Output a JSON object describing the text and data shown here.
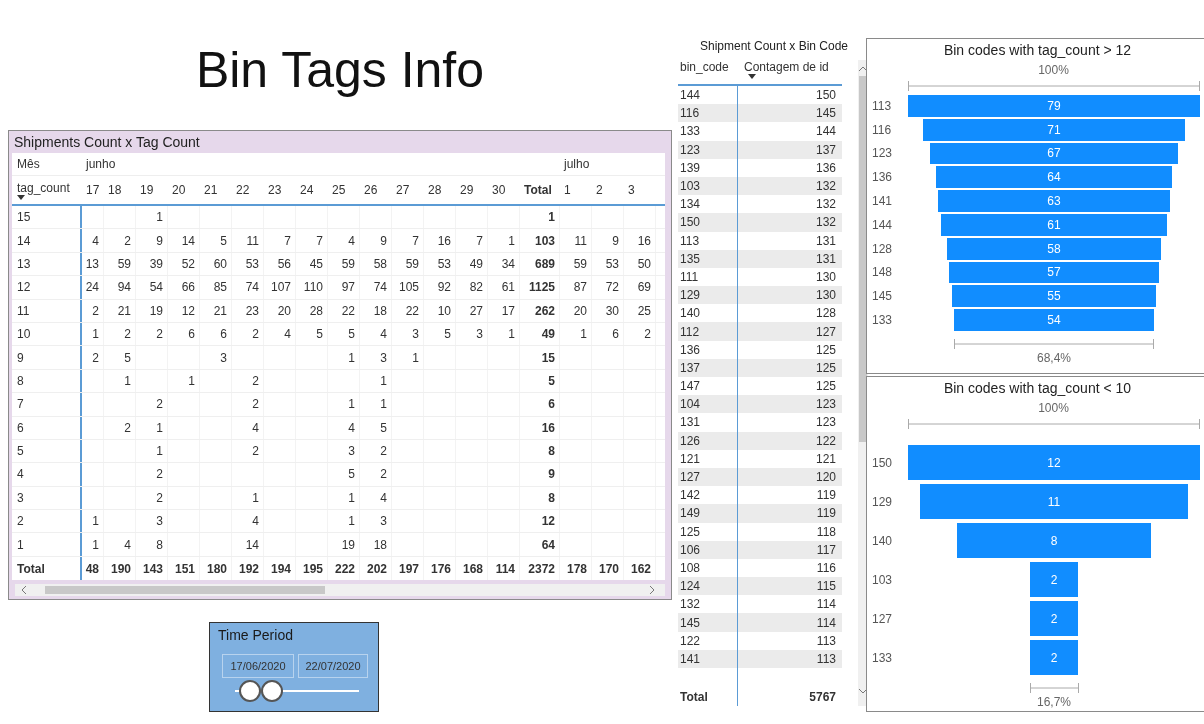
{
  "page_title": "Bin Tags Info",
  "matrix": {
    "title": "Shipments Count x Tag Count",
    "month_header": "Mês",
    "row_header": {
      "label": "tag_count",
      "sorted": true
    },
    "columns": [
      {
        "label": "17",
        "kind": "day",
        "month": "junho"
      },
      {
        "label": "18",
        "kind": "day"
      },
      {
        "label": "19",
        "kind": "day"
      },
      {
        "label": "20",
        "kind": "day"
      },
      {
        "label": "21",
        "kind": "day"
      },
      {
        "label": "22",
        "kind": "day"
      },
      {
        "label": "23",
        "kind": "day"
      },
      {
        "label": "24",
        "kind": "day"
      },
      {
        "label": "25",
        "kind": "day"
      },
      {
        "label": "26",
        "kind": "day"
      },
      {
        "label": "27",
        "kind": "day"
      },
      {
        "label": "28",
        "kind": "day"
      },
      {
        "label": "29",
        "kind": "day"
      },
      {
        "label": "30",
        "kind": "day"
      },
      {
        "label": "Total",
        "kind": "total"
      },
      {
        "label": "1",
        "kind": "day",
        "month": "julho"
      },
      {
        "label": "2",
        "kind": "day"
      },
      {
        "label": "3",
        "kind": "day"
      }
    ],
    "rows": [
      {
        "label": "15",
        "kind": "value",
        "cells": [
          null,
          null,
          "1",
          null,
          null,
          null,
          null,
          null,
          null,
          null,
          null,
          null,
          null,
          null,
          "1",
          null,
          null,
          null
        ]
      },
      {
        "label": "14",
        "kind": "value",
        "cells": [
          "4",
          "2",
          "9",
          "14",
          "5",
          "11",
          "7",
          "7",
          "4",
          "9",
          "7",
          "16",
          "7",
          "1",
          "103",
          "11",
          "9",
          "16"
        ]
      },
      {
        "label": "13",
        "kind": "value",
        "cells": [
          "13",
          "59",
          "39",
          "52",
          "60",
          "53",
          "56",
          "45",
          "59",
          "58",
          "59",
          "53",
          "49",
          "34",
          "689",
          "59",
          "53",
          "50"
        ]
      },
      {
        "label": "12",
        "kind": "value",
        "cells": [
          "24",
          "94",
          "54",
          "66",
          "85",
          "74",
          "107",
          "110",
          "97",
          "74",
          "105",
          "92",
          "82",
          "61",
          "1125",
          "87",
          "72",
          "69"
        ]
      },
      {
        "label": "11",
        "kind": "value",
        "cells": [
          "2",
          "21",
          "19",
          "12",
          "21",
          "23",
          "20",
          "28",
          "22",
          "18",
          "22",
          "10",
          "27",
          "17",
          "262",
          "20",
          "30",
          "25"
        ]
      },
      {
        "label": "10",
        "kind": "value",
        "cells": [
          "1",
          "2",
          "2",
          "6",
          "6",
          "2",
          "4",
          "5",
          "5",
          "4",
          "3",
          "5",
          "3",
          "1",
          "49",
          "1",
          "6",
          "2"
        ]
      },
      {
        "label": "9",
        "kind": "value",
        "cells": [
          "2",
          "5",
          null,
          null,
          "3",
          null,
          null,
          null,
          "1",
          "3",
          "1",
          null,
          null,
          null,
          "15",
          null,
          null,
          null
        ]
      },
      {
        "label": "8",
        "kind": "value",
        "cells": [
          null,
          "1",
          null,
          "1",
          null,
          "2",
          null,
          null,
          null,
          "1",
          null,
          null,
          null,
          null,
          "5",
          null,
          null,
          null
        ]
      },
      {
        "label": "7",
        "kind": "value",
        "cells": [
          null,
          null,
          "2",
          null,
          null,
          "2",
          null,
          null,
          "1",
          "1",
          null,
          null,
          null,
          null,
          "6",
          null,
          null,
          null
        ]
      },
      {
        "label": "6",
        "kind": "value",
        "cells": [
          null,
          "2",
          "1",
          null,
          null,
          "4",
          null,
          null,
          "4",
          "5",
          null,
          null,
          null,
          null,
          "16",
          null,
          null,
          null
        ]
      },
      {
        "label": "5",
        "kind": "value",
        "cells": [
          null,
          null,
          "1",
          null,
          null,
          "2",
          null,
          null,
          "3",
          "2",
          null,
          null,
          null,
          null,
          "8",
          null,
          null,
          null
        ]
      },
      {
        "label": "4",
        "kind": "value",
        "cells": [
          null,
          null,
          "2",
          null,
          null,
          null,
          null,
          null,
          "5",
          "2",
          null,
          null,
          null,
          null,
          "9",
          null,
          null,
          null
        ]
      },
      {
        "label": "3",
        "kind": "value",
        "cells": [
          null,
          null,
          "2",
          null,
          null,
          "1",
          null,
          null,
          "1",
          "4",
          null,
          null,
          null,
          null,
          "8",
          null,
          null,
          null
        ]
      },
      {
        "label": "2",
        "kind": "value",
        "cells": [
          "1",
          null,
          "3",
          null,
          null,
          "4",
          null,
          null,
          "1",
          "3",
          null,
          null,
          null,
          null,
          "12",
          null,
          null,
          null
        ]
      },
      {
        "label": "1",
        "kind": "value",
        "cells": [
          "1",
          "4",
          "8",
          null,
          null,
          "14",
          null,
          null,
          "19",
          "18",
          null,
          null,
          null,
          null,
          "64",
          null,
          null,
          null
        ]
      },
      {
        "label": "Total",
        "kind": "total",
        "cells": [
          "48",
          "190",
          "143",
          "151",
          "180",
          "192",
          "194",
          "195",
          "222",
          "202",
          "197",
          "176",
          "168",
          "114",
          "2372",
          "178",
          "170",
          "162"
        ]
      }
    ]
  },
  "slicer": {
    "title": "Time Period",
    "start_date": "17/06/2020",
    "end_date": "22/07/2020",
    "thumbs": [
      {
        "level": 0.08
      },
      {
        "level": 0.26
      }
    ]
  },
  "bin_table": {
    "title": "Shipment Count x Bin Code",
    "columns": [
      {
        "label": "bin_code",
        "sorted": false
      },
      {
        "label": "Contagem de id",
        "sorted": true
      }
    ],
    "rows": [
      [
        "144",
        "150"
      ],
      [
        "116",
        "145"
      ],
      [
        "133",
        "144"
      ],
      [
        "123",
        "137"
      ],
      [
        "139",
        "136"
      ],
      [
        "103",
        "132"
      ],
      [
        "134",
        "132"
      ],
      [
        "150",
        "132"
      ],
      [
        "113",
        "131"
      ],
      [
        "135",
        "131"
      ],
      [
        "111",
        "130"
      ],
      [
        "129",
        "130"
      ],
      [
        "140",
        "128"
      ],
      [
        "112",
        "127"
      ],
      [
        "136",
        "125"
      ],
      [
        "137",
        "125"
      ],
      [
        "147",
        "125"
      ],
      [
        "104",
        "123"
      ],
      [
        "131",
        "123"
      ],
      [
        "126",
        "122"
      ],
      [
        "121",
        "121"
      ],
      [
        "127",
        "120"
      ],
      [
        "142",
        "119"
      ],
      [
        "149",
        "119"
      ],
      [
        "125",
        "118"
      ],
      [
        "106",
        "117"
      ],
      [
        "108",
        "116"
      ],
      [
        "124",
        "115"
      ],
      [
        "132",
        "114"
      ],
      [
        "145",
        "114"
      ],
      [
        "122",
        "113"
      ],
      [
        "141",
        "113"
      ]
    ],
    "total": {
      "label": "Total",
      "value": "5767"
    }
  },
  "funnels": [
    {
      "title": "Bin codes with tag_count > 12",
      "top_label": "100%",
      "bottom_label": "68,4%",
      "stages": [
        {
          "label": "113",
          "value": "79"
        },
        {
          "label": "116",
          "value": "71"
        },
        {
          "label": "123",
          "value": "67"
        },
        {
          "label": "136",
          "value": "64"
        },
        {
          "label": "141",
          "value": "63"
        },
        {
          "label": "144",
          "value": "61"
        },
        {
          "label": "128",
          "value": "58"
        },
        {
          "label": "148",
          "value": "57"
        },
        {
          "label": "145",
          "value": "55"
        },
        {
          "label": "133",
          "value": "54"
        }
      ]
    },
    {
      "title": "Bin codes with tag_count < 10",
      "top_label": "100%",
      "bottom_label": "16,7%",
      "stages": [
        {
          "label": "150",
          "value": "12"
        },
        {
          "label": "129",
          "value": "11"
        },
        {
          "label": "140",
          "value": "8"
        },
        {
          "label": "103",
          "value": "2"
        },
        {
          "label": "127",
          "value": "2"
        },
        {
          "label": "133",
          "value": "2"
        }
      ]
    }
  ]
}
